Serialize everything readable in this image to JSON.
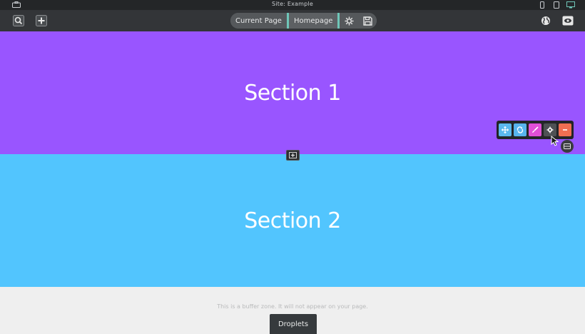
{
  "window": {
    "title": "Site: Example"
  },
  "toolbar": {
    "current_page_label": "Current Page",
    "page_name": "Homepage",
    "left_buttons": [
      "search-icon",
      "add-icon"
    ],
    "right_buttons": [
      "globe-icon",
      "preview-icon"
    ]
  },
  "devices": [
    "mobile-icon",
    "tablet-icon",
    "desktop-icon"
  ],
  "sections": [
    {
      "title": "Section 1",
      "color": "#9955ff"
    },
    {
      "title": "Section 2",
      "color": "#52c5fe"
    }
  ],
  "section_controls": [
    "move-icon",
    "recycle-icon",
    "brush-icon",
    "gear-icon",
    "remove-icon"
  ],
  "buffer": {
    "text": "This is a buffer zone. It will not appear on your page."
  },
  "droplets": {
    "label": "Droplets"
  },
  "colors": {
    "accent": "#6fc6b8",
    "toolbar_bg": "#333538"
  }
}
